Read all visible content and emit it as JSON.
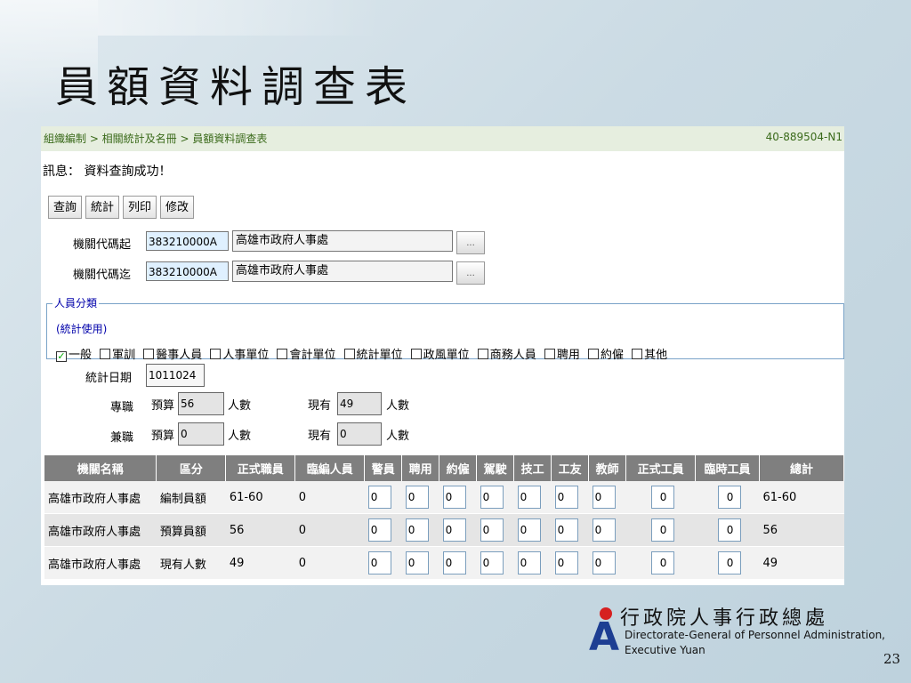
{
  "slide_title": "員額資料調查表",
  "breadcrumb": "組織編制 > 相關統計及名冊 > 員額資料調查表",
  "form_id": "40-889504-N1",
  "message": "訊息： 資料查詢成功！",
  "toolbar": {
    "query": "查詢",
    "stats": "統計",
    "print": "列印",
    "edit": "修改"
  },
  "agency_from": {
    "label": "機關代碼起",
    "code": "383210000A",
    "name": "高雄市政府人事處"
  },
  "agency_to": {
    "label": "機關代碼迄",
    "code": "383210000A",
    "name": "高雄市政府人事處"
  },
  "picker_label": "...",
  "category": {
    "legend": "人員分類",
    "sub": "(統計使用)",
    "options": [
      {
        "label": "一般",
        "checked": true
      },
      {
        "label": "軍訓",
        "checked": false
      },
      {
        "label": "醫事人員",
        "checked": false
      },
      {
        "label": "人事單位",
        "checked": false
      },
      {
        "label": "會計單位",
        "checked": false
      },
      {
        "label": "統計單位",
        "checked": false
      },
      {
        "label": "政風單位",
        "checked": false
      },
      {
        "label": "商務人員",
        "checked": false
      },
      {
        "label": "聘用",
        "checked": false
      },
      {
        "label": "約僱",
        "checked": false
      },
      {
        "label": "其他",
        "checked": false
      }
    ],
    "check_mark": "✓"
  },
  "stat_date": {
    "label": "統計日期",
    "value": "1011024"
  },
  "fulltime": {
    "label": "專職",
    "budget_label": "預算",
    "budget": "56",
    "unit": "人數",
    "current_label": "現有",
    "current": "49"
  },
  "parttime": {
    "label": "兼職",
    "budget_label": "預算",
    "budget": "0",
    "unit": "人數",
    "current_label": "現有",
    "current": "0"
  },
  "table": {
    "headers": [
      "機關名稱",
      "區分",
      "正式職員",
      "臨編人員",
      "警員",
      "聘用",
      "約僱",
      "駕駛",
      "技工",
      "工友",
      "教師",
      "正式工員",
      "臨時工員",
      "總計"
    ],
    "rows": [
      [
        "高雄市政府人事處",
        "編制員額",
        "61-60",
        "0",
        "0",
        "0",
        "0",
        "0",
        "0",
        "0",
        "0",
        "0",
        "0",
        "61-60"
      ],
      [
        "高雄市政府人事處",
        "預算員額",
        "56",
        "0",
        "0",
        "0",
        "0",
        "0",
        "0",
        "0",
        "0",
        "0",
        "0",
        "56"
      ],
      [
        "高雄市政府人事處",
        "現有人數",
        "49",
        "0",
        "0",
        "0",
        "0",
        "0",
        "0",
        "0",
        "0",
        "0",
        "0",
        "49"
      ]
    ]
  },
  "footer": {
    "org_cn": "行政院人事行政總處",
    "org_en_1": "Directorate-General of Personnel Administration,",
    "org_en_2": "Executive Yuan",
    "logo_letter": "A",
    "page_number": "23"
  }
}
